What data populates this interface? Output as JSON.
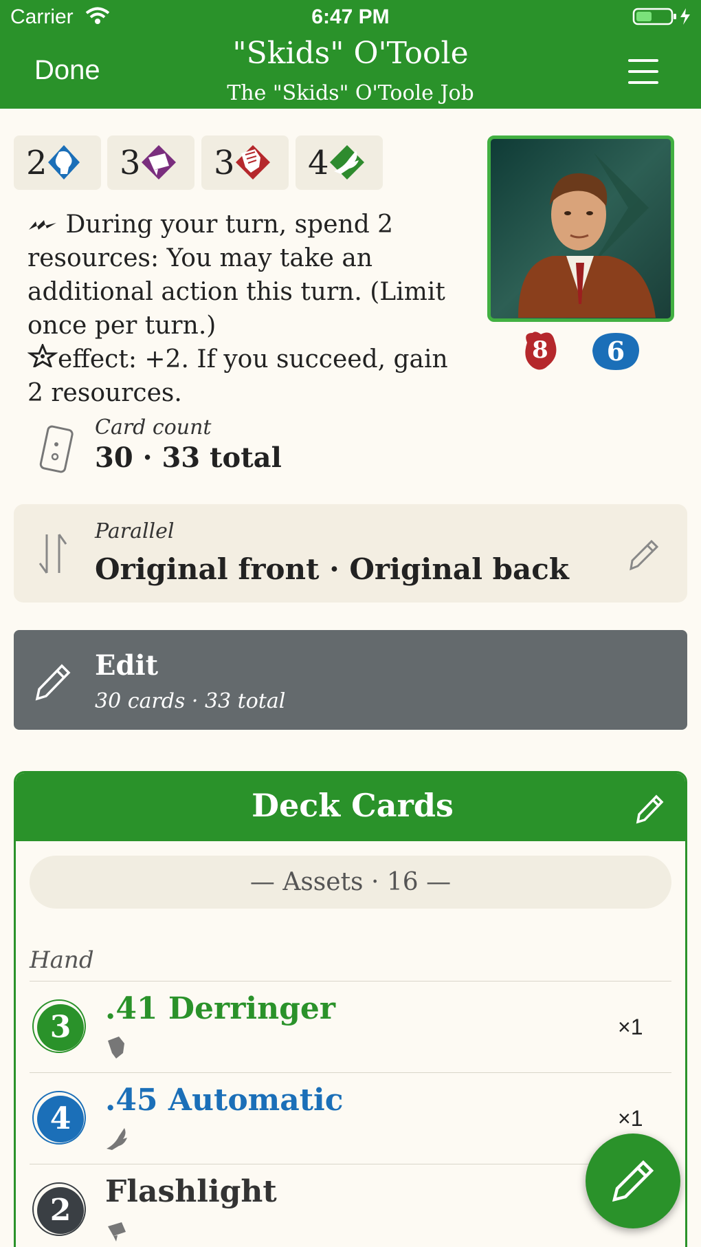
{
  "status_bar": {
    "carrier": "Carrier",
    "time": "6:47 PM"
  },
  "header": {
    "done_label": "Done",
    "title": "\"Skids\" O'Toole",
    "subtitle": "The \"Skids\" O'Toole Job"
  },
  "skills": [
    {
      "name": "willpower",
      "value": "2",
      "icon": "willpower-icon",
      "color": "#1b6fb8"
    },
    {
      "name": "intellect",
      "value": "3",
      "icon": "intellect-icon",
      "color": "#7a2e7e"
    },
    {
      "name": "combat",
      "value": "3",
      "icon": "combat-icon",
      "color": "#b5282c"
    },
    {
      "name": "agility",
      "value": "4",
      "icon": "agility-icon",
      "color": "#2e8b2e"
    }
  ],
  "ability_text": {
    "line1": "During your turn, spend 2 resources: You may take an additional action this turn. (Limit once per turn.)",
    "line2": "effect: +2. If you succeed, gain 2 resources."
  },
  "stats": {
    "health": "8",
    "sanity": "6"
  },
  "card_count": {
    "label": "Card count",
    "value": "30 · 33 total"
  },
  "parallel": {
    "label": "Parallel",
    "value": "Original front · Original back"
  },
  "edit": {
    "title": "Edit",
    "subtitle": "30 cards · 33 total"
  },
  "deck": {
    "title": "Deck Cards",
    "section": "— Assets · 16 —",
    "group": "Hand",
    "cards": [
      {
        "cost": "3",
        "name": ".41 Derringer",
        "qty": "×1",
        "color": "#2a922a",
        "icon": "combat-icon"
      },
      {
        "cost": "4",
        "name": ".45 Automatic",
        "qty": "×1",
        "color": "#1b6fb8",
        "icon": "agility-icon"
      },
      {
        "cost": "2",
        "name": "Flashlight",
        "qty": "",
        "color": "#3a3f44",
        "icon": "intellect-icon"
      }
    ]
  }
}
